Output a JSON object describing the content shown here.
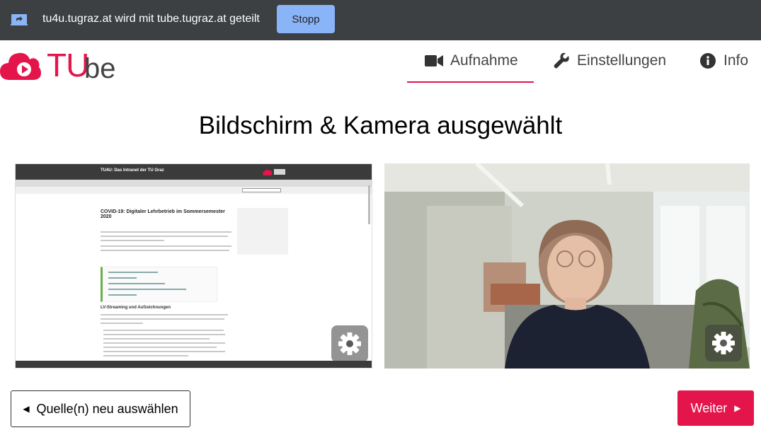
{
  "sharebar": {
    "text": "tu4u.tugraz.at wird mit tube.tugraz.at geteilt",
    "stop_label": "Stopp",
    "icon": "screen-share-icon"
  },
  "logo": {
    "tu": "TU",
    "be": "be"
  },
  "nav": {
    "aufnahme": "Aufnahme",
    "einstellungen": "Einstellungen",
    "info": "Info"
  },
  "page_title": "Bildschirm & Kamera ausgewählt",
  "screen_preview": {
    "site_title": "TU4U: Das Intranet der TU Graz",
    "article_heading": "COVID-19: Digitaler Lehrbetrieb im Sommersemester 2020",
    "section_heading": "LV-Streaming und Aufzeichnungen"
  },
  "buttons": {
    "back_label": "Quelle(n) neu auswählen",
    "next_label": "Weiter"
  },
  "colors": {
    "accent": "#e4154b",
    "sharebar": "#3c4043",
    "stop_button": "#8ab4f8"
  }
}
